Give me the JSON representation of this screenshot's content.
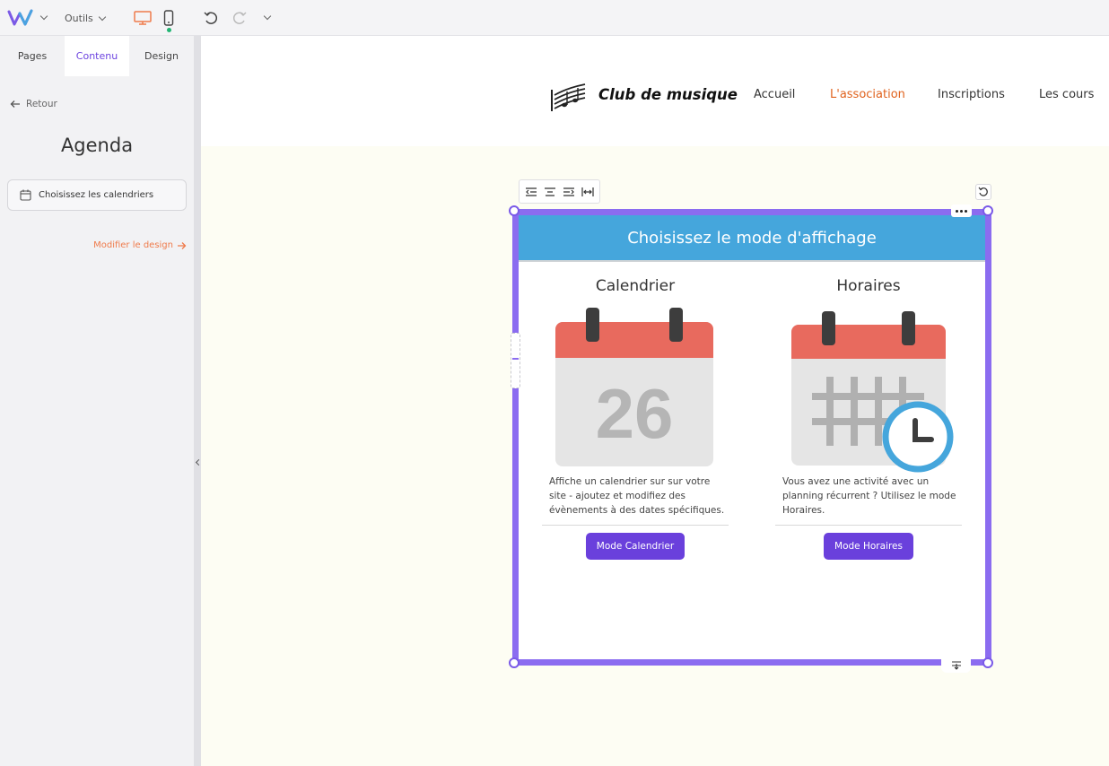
{
  "topbar": {
    "logo": "W",
    "tools_label": "Outils",
    "icons": [
      "w-logo-icon",
      "chevron-down-icon",
      "desktop-icon",
      "mobile-icon",
      "undo-icon",
      "redo-icon",
      "chevron-down-icon"
    ]
  },
  "leftpanel": {
    "tabs": [
      {
        "label": "Pages"
      },
      {
        "label": "Contenu"
      },
      {
        "label": "Design"
      }
    ],
    "active_tab": "Contenu",
    "back_label": "Retour",
    "title": "Agenda",
    "calendar_select_label": "Choisissez les calendriers",
    "design_link": "Modifier le design"
  },
  "site": {
    "name": "Club de musique",
    "nav": [
      "Accueil",
      "L'association",
      "Inscriptions",
      "Les cours"
    ],
    "active_nav": "L'association"
  },
  "widget": {
    "header": "Choisissez le mode d'affichage",
    "modes": [
      {
        "title": "Calendrier",
        "day_number": "26",
        "description": "Affiche un calendrier sur sur votre site - ajoutez et modifiez des évènements à des dates spécifiques.",
        "button": "Mode Calendrier"
      },
      {
        "title": "Horaires",
        "description": "Vous avez une activité avec un planning récurrent ? Utilisez le mode Horaires.",
        "button": "Mode Horaires"
      }
    ]
  },
  "colors": {
    "accent": "#6a40dc",
    "selection": "#8b6cf0",
    "orange": "#ef7b4b",
    "widget_header": "#45a6dc",
    "calendar_red": "#e86a5e",
    "clock_blue": "#45a6dc"
  }
}
